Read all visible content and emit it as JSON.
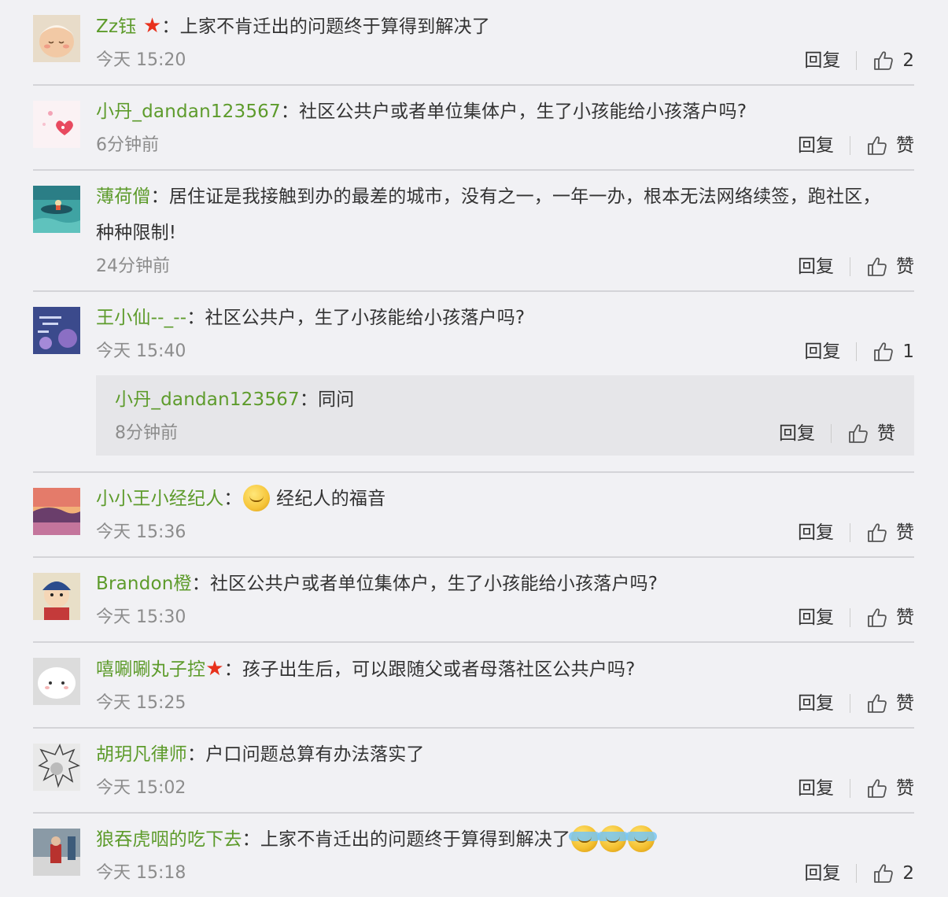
{
  "comments": [
    {
      "user": "Zz钰",
      "star": true,
      "sep": "：",
      "text": "上家不肯迁出的问题终于算得到解决了",
      "time": "今天 15:20",
      "reply": "回复",
      "like": "2",
      "avatar": "baby-avatar"
    },
    {
      "user": "小丹_dandan123567",
      "star": false,
      "sep": "：",
      "text": "社区公共户或者单位集体户，生了小孩能给小孩落户吗?",
      "time": "6分钟前",
      "reply": "回复",
      "like": "赞",
      "avatar": "heart-avatar"
    },
    {
      "user": "薄荷僧",
      "star": false,
      "sep": "：",
      "text": "居住证是我接触到办的最差的城市，没有之一，一年一办，根本无法网络续签，跑社区，",
      "text2": "种种限制!",
      "time": "24分钟前",
      "reply": "回复",
      "like": "赞",
      "avatar": "boat-avatar"
    },
    {
      "user": "王小仙--_--",
      "star": false,
      "sep": "：",
      "text": "社区公共户，生了小孩能给小孩落户吗?",
      "time": "今天 15:40",
      "reply": "回复",
      "like": "1",
      "avatar": "purple-avatar",
      "sub": {
        "user": "小丹_dandan123567",
        "sep": "：",
        "text": "同问",
        "time": "8分钟前",
        "reply": "回复",
        "like": "赞"
      }
    },
    {
      "user": "小小王小经纪人",
      "star": false,
      "sep": "：",
      "text": "经纪人的福音",
      "time": "今天 15:36",
      "reply": "回复",
      "like": "赞",
      "avatar": "sunset-avatar"
    },
    {
      "user": "Brandon橙",
      "star": false,
      "sep": "：",
      "text": "社区公共户或者单位集体户，生了小孩能给小孩落户吗?",
      "time": "今天 15:30",
      "reply": "回复",
      "like": "赞",
      "avatar": "cartoon-avatar"
    },
    {
      "user": "嘻唰唰丸子控",
      "star": true,
      "sep": "：",
      "text": "孩子出生后，可以跟随父或者母落社区公共户吗?",
      "time": "今天 15:25",
      "reply": "回复",
      "like": "赞",
      "avatar": "blob-avatar"
    },
    {
      "user": "胡玥凡律师",
      "star": false,
      "sep": "：",
      "text": "户口问题总算有办法落实了",
      "time": "今天 15:02",
      "reply": "回复",
      "like": "赞",
      "avatar": "sketch-avatar"
    },
    {
      "user": "狼吞虎咽的吃下去",
      "star": false,
      "sep": "：",
      "text": "上家不肯迁出的问题终于算得到解决了",
      "time": "今天 15:18",
      "reply": "回复",
      "like": "2",
      "avatar": "photo-avatar"
    }
  ],
  "colors": {
    "username": "#5d9b2b",
    "star": "#e8311c",
    "background": "#f1f1f4"
  }
}
